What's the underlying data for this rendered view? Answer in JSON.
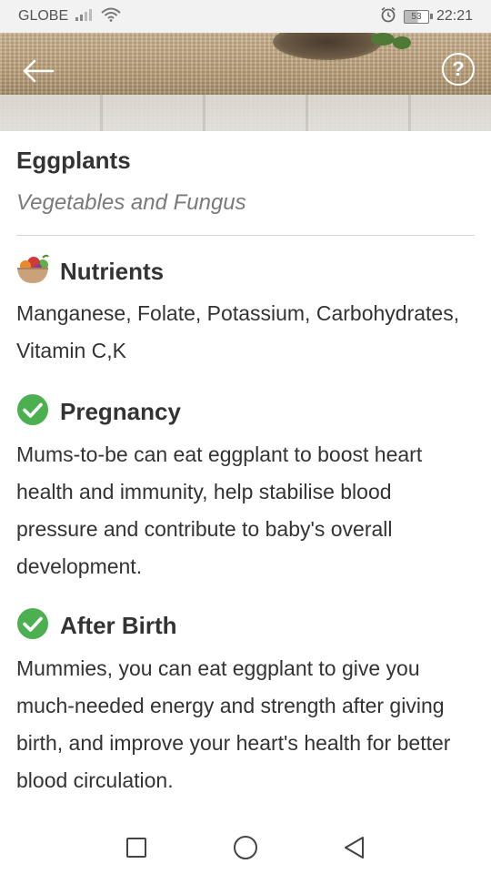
{
  "status_bar": {
    "carrier": "GLOBE",
    "battery_level": "53",
    "time": "22:21",
    "icons": [
      "signal-icon",
      "wifi-icon",
      "alarm-icon",
      "battery-icon"
    ]
  },
  "header": {
    "back_icon": "arrow-left-icon",
    "help_label": "?"
  },
  "food": {
    "name": "Eggplants",
    "category": "Vegetables and Fungus"
  },
  "sections": {
    "nutrients": {
      "title": "Nutrients",
      "icon": "fruit-bowl-icon",
      "body": "Manganese, Folate, Potassium, Carbohydrates, Vitamin C,K"
    },
    "pregnancy": {
      "title": "Pregnancy",
      "icon": "check-circle-icon",
      "body": "Mums-to-be can eat eggplant to boost heart health and immunity, help stabilise blood pressure and contribute to baby's overall development."
    },
    "after_birth": {
      "title": "After Birth",
      "icon": "check-circle-icon",
      "body": "Mummies, you can eat eggplant to give you much-needed energy and strength after giving birth, and improve your heart's health for better blood circulation."
    }
  },
  "colors": {
    "check_green": "#4caf50",
    "text_dark": "#333333",
    "text_muted": "#7a7a7a"
  },
  "nav_bar": {
    "icons": [
      "recents-square-icon",
      "home-circle-icon",
      "back-triangle-icon"
    ]
  }
}
